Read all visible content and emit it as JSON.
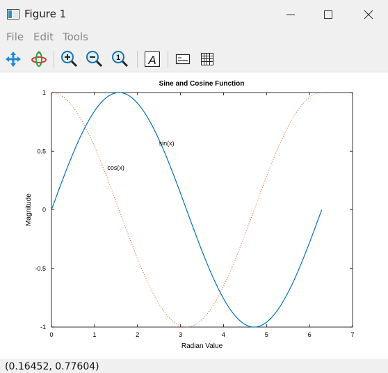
{
  "window": {
    "title": "Figure 1"
  },
  "menu": {
    "items": [
      "File",
      "Edit",
      "Tools"
    ]
  },
  "toolbar": {
    "buttons": [
      "pan-icon",
      "rotate-icon",
      "zoom-in-icon",
      "zoom-out-icon",
      "zoom-reset-icon",
      "text-icon",
      "legend-icon",
      "grid-icon"
    ]
  },
  "status": {
    "coords": "(0.16452, 0.77604)"
  },
  "colors": {
    "sin": "#0072bd",
    "cos": "#d95319",
    "chrome": "#f0f0f0"
  },
  "chart_data": {
    "type": "line",
    "title": "Sine and Cosine Function",
    "xlabel": "Radian Value",
    "ylabel": "Magnitude",
    "xlim": [
      0,
      7
    ],
    "ylim": [
      -1,
      1
    ],
    "xticks": [
      0,
      1,
      2,
      3,
      4,
      5,
      6,
      7
    ],
    "yticks": [
      -1,
      -0.5,
      0,
      0.5,
      1
    ],
    "ytick_labels": [
      "-1",
      "-0.5",
      "0",
      "0.5",
      "1"
    ],
    "grid": false,
    "legend": "none",
    "series": [
      {
        "key": "sin",
        "style": "solid",
        "x_range": [
          0,
          6.2832
        ],
        "points": 200
      },
      {
        "key": "cos",
        "style": "dotted",
        "x_range": [
          0,
          6.2832
        ],
        "points": 200
      }
    ],
    "annotations": [
      {
        "text": "sin(x)",
        "x": 2.5,
        "y": 0.55
      },
      {
        "text": "cos(x)",
        "x": 1.3,
        "y": 0.34
      }
    ]
  }
}
